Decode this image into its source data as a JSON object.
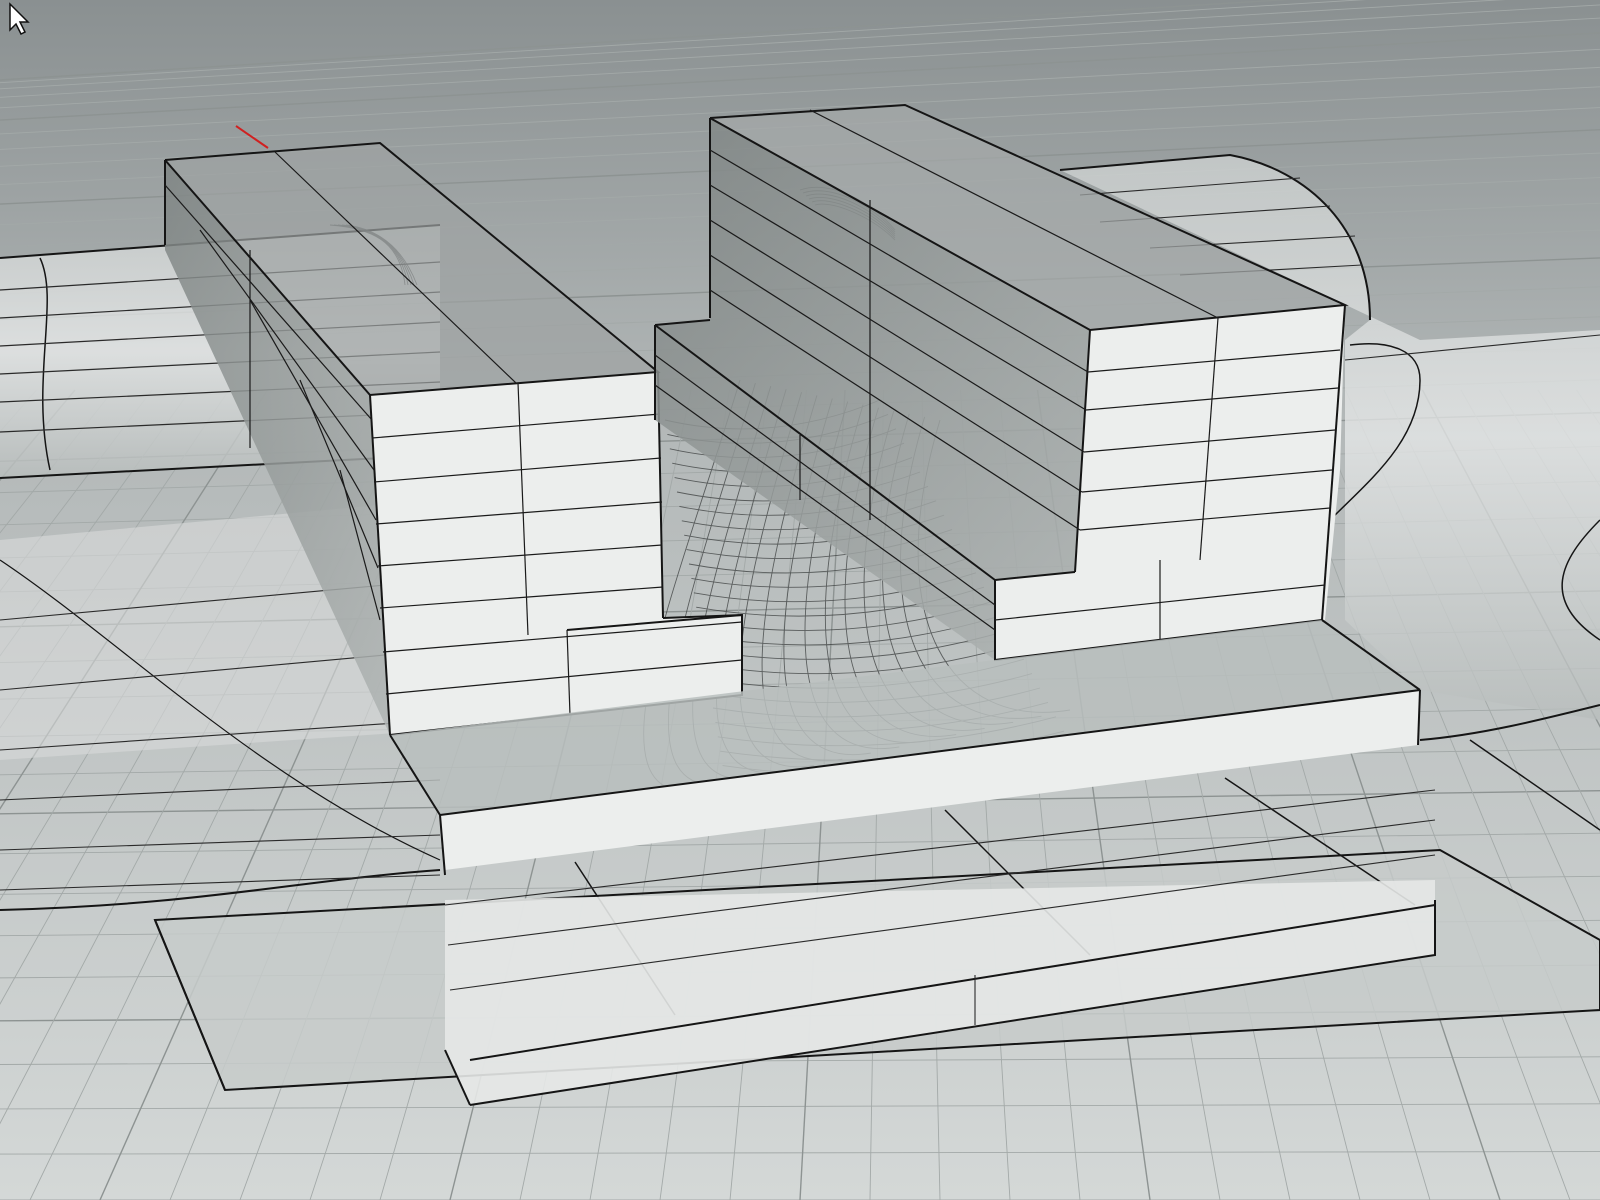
{
  "viewport": {
    "view": "perspective",
    "display_mode": "ghosted",
    "colors": {
      "background_top": "#8f9596",
      "background_bottom": "#d2d6d5",
      "grid_line": "#a9afae",
      "grid_major": "#8f9594",
      "edge": "#151515",
      "face_light": "#eef0ef",
      "face_mid": "#c9cdcc",
      "face_dark": "#8e9392",
      "world_axis_x": "#d02020"
    }
  },
  "objects": [
    {
      "name": "left-cylinder",
      "kind": "cylinder"
    },
    {
      "name": "right-cylinder",
      "kind": "cylinder"
    },
    {
      "name": "left-column-block",
      "kind": "box"
    },
    {
      "name": "right-column-block",
      "kind": "box"
    },
    {
      "name": "center-curved-surface",
      "kind": "surface"
    },
    {
      "name": "front-base-slab",
      "kind": "box"
    },
    {
      "name": "ground-plate",
      "kind": "planar-surface"
    }
  ],
  "cursor": {
    "icon": "mouse-pointer-icon"
  }
}
